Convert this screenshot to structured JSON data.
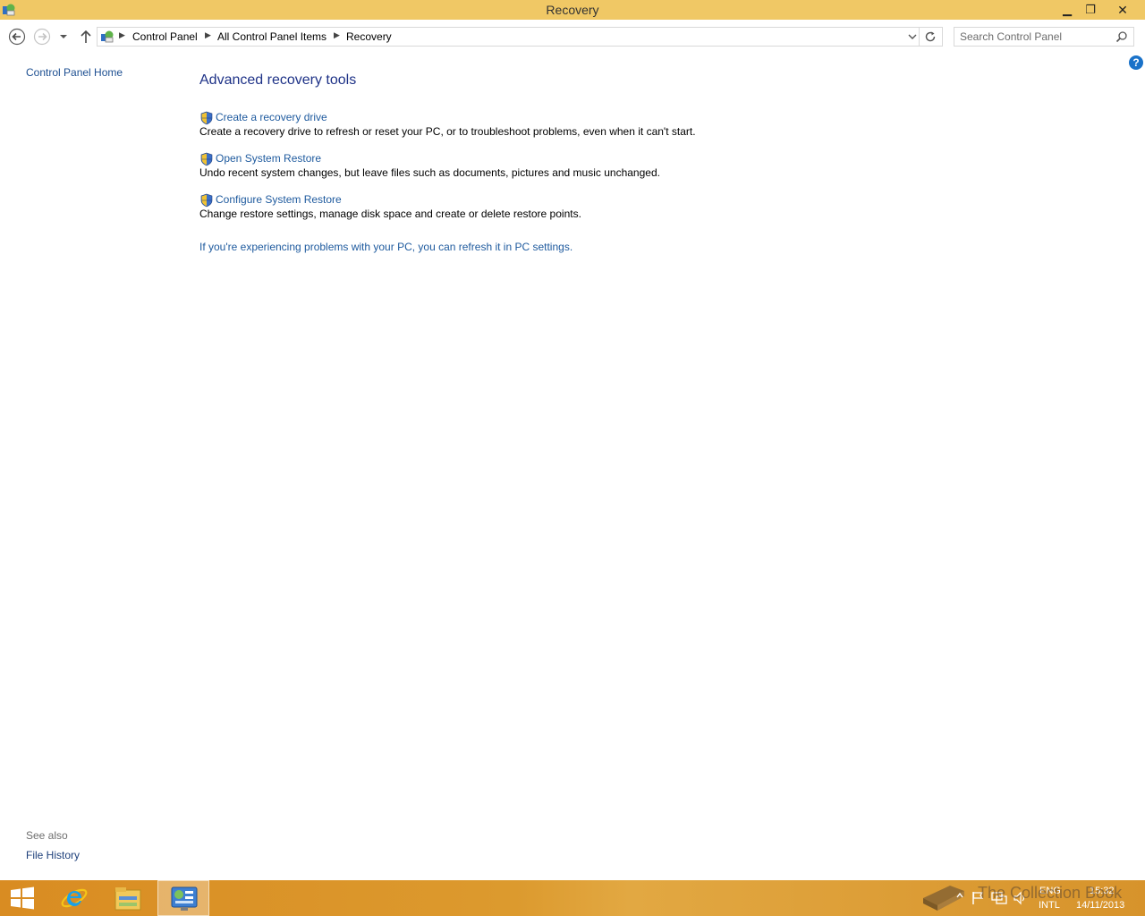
{
  "window": {
    "title": "Recovery",
    "minimize_glyph": "▁",
    "maximize_glyph": "❐",
    "close_glyph": "✕"
  },
  "address": {
    "crumbs": [
      "Control Panel",
      "All Control Panel Items",
      "Recovery"
    ],
    "search_placeholder": "Search Control Panel"
  },
  "help": {
    "glyph": "?"
  },
  "left_pane": {
    "home_link": "Control Panel Home",
    "see_also_label": "See also",
    "see_also_links": [
      "File History"
    ]
  },
  "main": {
    "heading": "Advanced recovery tools",
    "tasks": [
      {
        "link": "Create a recovery drive",
        "desc": "Create a recovery drive to refresh or reset your PC, or to troubleshoot problems, even when it can't start."
      },
      {
        "link": "Open System Restore",
        "desc": "Undo recent system changes, but leave files such as documents, pictures and music unchanged."
      },
      {
        "link": "Configure System Restore",
        "desc": "Change restore settings, manage disk space and create or delete restore points."
      }
    ],
    "refresh_link": "If you're experiencing problems with your PC, you can refresh it in PC settings."
  },
  "taskbar": {
    "language": "ENG",
    "keyboard_layout": "INTL",
    "time": "15:32",
    "date": "14/11/2013",
    "watermark": "The Collection Book"
  },
  "colors": {
    "titlebar": "#f0c865",
    "link": "#1e5a9e",
    "heading": "#1e3287",
    "taskbar": "#d98c22"
  }
}
